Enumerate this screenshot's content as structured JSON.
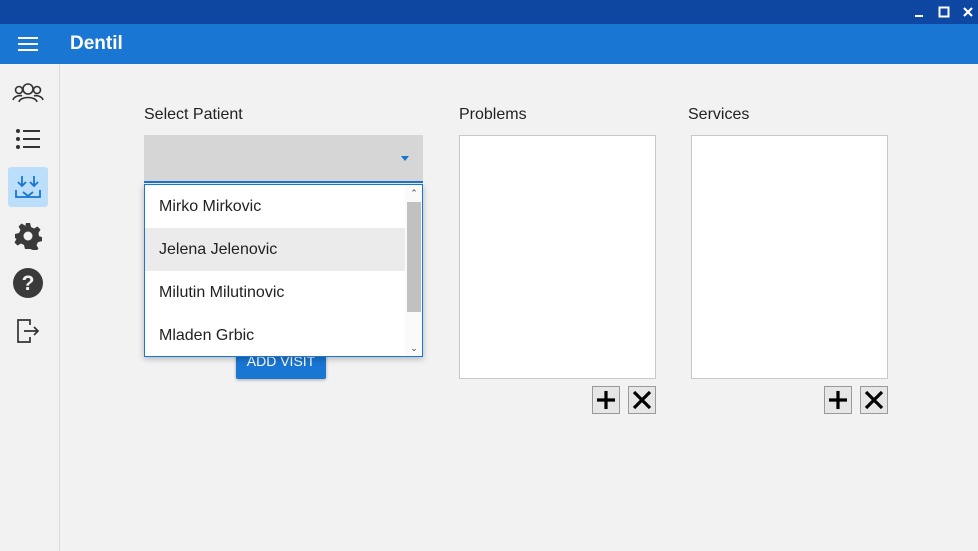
{
  "app": {
    "title": "Dentil"
  },
  "window_controls": {
    "minimize": "minimize-icon",
    "maximize": "maximize-icon",
    "close": "close-icon"
  },
  "sidebar": {
    "items": [
      {
        "icon": "patients-icon",
        "active": false
      },
      {
        "icon": "list-icon",
        "active": false
      },
      {
        "icon": "download-icon",
        "active": true
      },
      {
        "icon": "gear-icon",
        "active": false
      },
      {
        "icon": "help-icon",
        "active": false
      },
      {
        "icon": "logout-icon",
        "active": false
      }
    ]
  },
  "patient": {
    "label": "Select Patient",
    "selected": "",
    "options": [
      "Mirko Mirkovic",
      "Jelena Jelenovic",
      "Milutin Milutinovic",
      "Mladen Grbic"
    ]
  },
  "add_visit_label": "ADD VISIT",
  "problems": {
    "label": "Problems"
  },
  "services": {
    "label": "Services"
  },
  "colors": {
    "titlebar": "#0d47a1",
    "appbar": "#1976d2",
    "accent": "#1976d2",
    "active_side": "#bbdefb"
  }
}
